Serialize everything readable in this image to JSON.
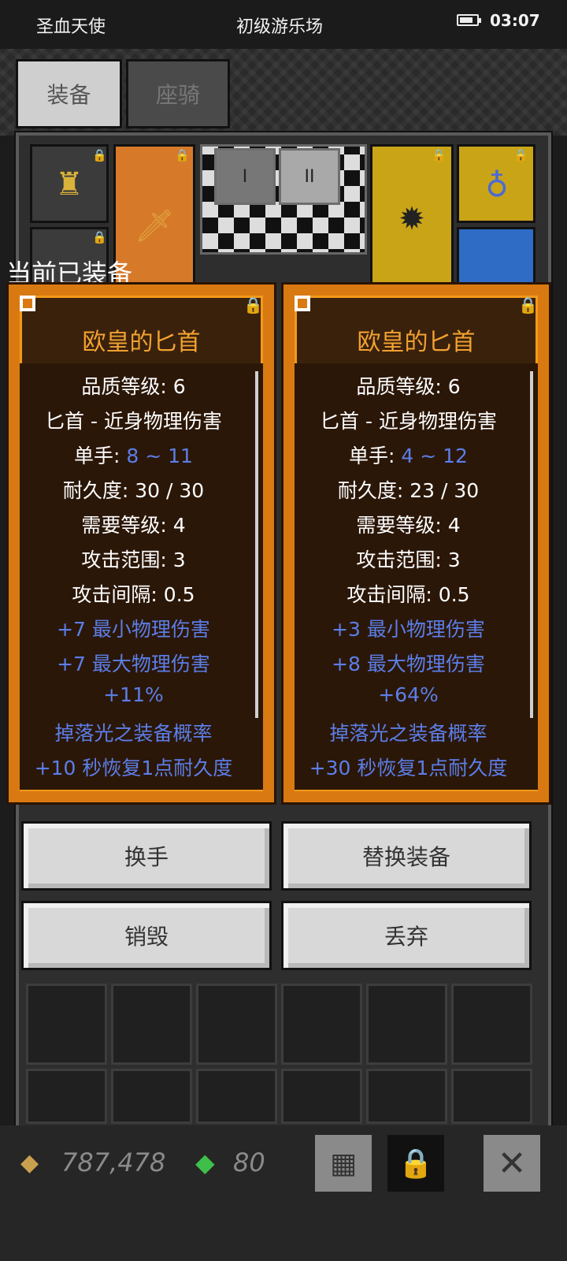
{
  "status_bar": {
    "left_text": "圣血天使",
    "center_text": "初级游乐场",
    "time": "03:07"
  },
  "tabs": [
    {
      "label": "装备",
      "active": true
    },
    {
      "label": "座骑",
      "active": false
    }
  ],
  "equipment_view": {
    "page_buttons": [
      "I",
      "II"
    ],
    "slot_icons": {
      "helmet": "helmet-icon",
      "weapon": "dagger-icon",
      "offhand": "mine-icon",
      "amulet": "amulet-icon"
    }
  },
  "current_label": "当前已装备",
  "cards": [
    {
      "title": "欧皇的匕首",
      "quality": "品质等级: 6",
      "type": "匕首 - 近身物理伤害",
      "hand_label": "单手: ",
      "hand_value": "8 ~ 11",
      "durability": "耐久度: 30 / 30",
      "level_req": "需要等级: 4",
      "range": "攻击范围: 3",
      "interval": "攻击间隔: 0.5",
      "bonus1": "+7 最小物理伤害",
      "bonus2": "+7 最大物理伤害",
      "bonus3": "+11%",
      "bonus4": "掉落光之装备概率",
      "bonus5": "+10 秒恢复1点耐久度"
    },
    {
      "title": "欧皇的匕首",
      "quality": "品质等级: 6",
      "type": "匕首 - 近身物理伤害",
      "hand_label": "单手: ",
      "hand_value": "4 ~ 12",
      "durability": "耐久度: 23 / 30",
      "level_req": "需要等级: 4",
      "range": "攻击范围: 3",
      "interval": "攻击间隔: 0.5",
      "bonus1": "+3 最小物理伤害",
      "bonus2": "+8 最大物理伤害",
      "bonus3": "+64%",
      "bonus4": "掉落光之装备概率",
      "bonus5": "+30 秒恢复1点耐久度"
    }
  ],
  "actions": {
    "swap": "换手",
    "replace": "替换装备",
    "destroy": "销毁",
    "drop": "丢弃"
  },
  "bottom_bar": {
    "gold": "787,478",
    "gems": "80",
    "gold_icon": "gold-icon",
    "gem_icon": "gem-icon"
  },
  "colors": {
    "card_orange": "#d87a11",
    "title_orange": "#f2a230",
    "bonus_blue": "#5b7ee8"
  }
}
